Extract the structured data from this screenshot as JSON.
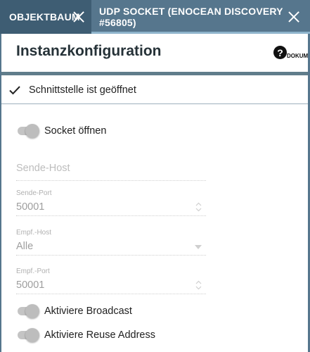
{
  "tabs": [
    {
      "label": "OBJEKTBAUM"
    },
    {
      "label": "UDP SOCKET (ENOCEAN DISCOVERY #56805)"
    }
  ],
  "panel": {
    "title": "Instanzkonfiguration",
    "help_label": "DOKUM",
    "help_glyph": "?"
  },
  "status": {
    "text": "Schnittstelle ist geöffnet",
    "icon": "checkmark-icon"
  },
  "form": {
    "socket_open_label": "Socket öffnen",
    "send_host": {
      "placeholder": "Sende-Host",
      "value": ""
    },
    "send_port": {
      "label": "Sende-Port",
      "value": "50001"
    },
    "recv_host": {
      "label": "Empf.-Host",
      "value": "Alle"
    },
    "recv_port": {
      "label": "Empf.-Port",
      "value": "50001"
    },
    "broadcast_label": "Aktiviere Broadcast",
    "reuse_label": "Aktiviere Reuse Address"
  },
  "colors": {
    "tabbar": "#3e5d73",
    "active_tab": "#56768d",
    "accent_underline": "#8fb4cc",
    "header_bar": "#607d8b"
  }
}
